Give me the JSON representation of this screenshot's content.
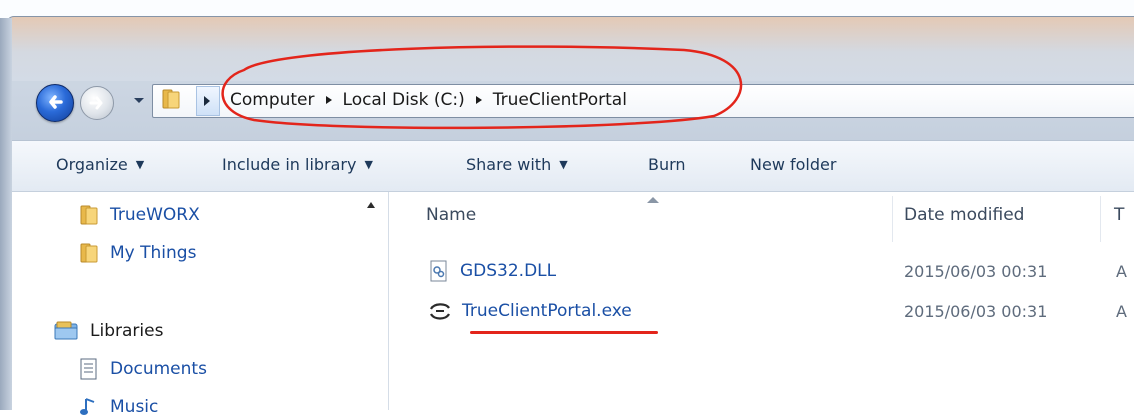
{
  "address_bar": {
    "crumbs": [
      "Computer",
      "Local Disk (C:)",
      "TrueClientPortal"
    ]
  },
  "toolbar": {
    "organize": "Organize",
    "include_in_library": "Include in library",
    "share_with": "Share with",
    "burn": "Burn",
    "new_folder": "New folder"
  },
  "navpane": {
    "items": [
      {
        "label": "TrueWORX",
        "icon": "folder-icon"
      },
      {
        "label": "My Things",
        "icon": "folder-icon"
      },
      {
        "label": "Libraries",
        "icon": "libraries-icon"
      },
      {
        "label": "Documents",
        "icon": "documents-icon"
      },
      {
        "label": "Music",
        "icon": "music-icon"
      }
    ]
  },
  "columns": {
    "name": "Name",
    "date_modified": "Date modified",
    "type": "T"
  },
  "files": [
    {
      "name": "GDS32.DLL",
      "date": "2015/06/03 00:31",
      "type": "A",
      "icon": "dll-file-icon"
    },
    {
      "name": "TrueClientPortal.exe",
      "date": "2015/06/03 00:31",
      "type": "A",
      "icon": "exe-file-icon"
    }
  ],
  "colors": {
    "annotation_red": "#e3251b",
    "link_blue": "#1a4fa5",
    "toolbar_text": "#1e395b"
  }
}
